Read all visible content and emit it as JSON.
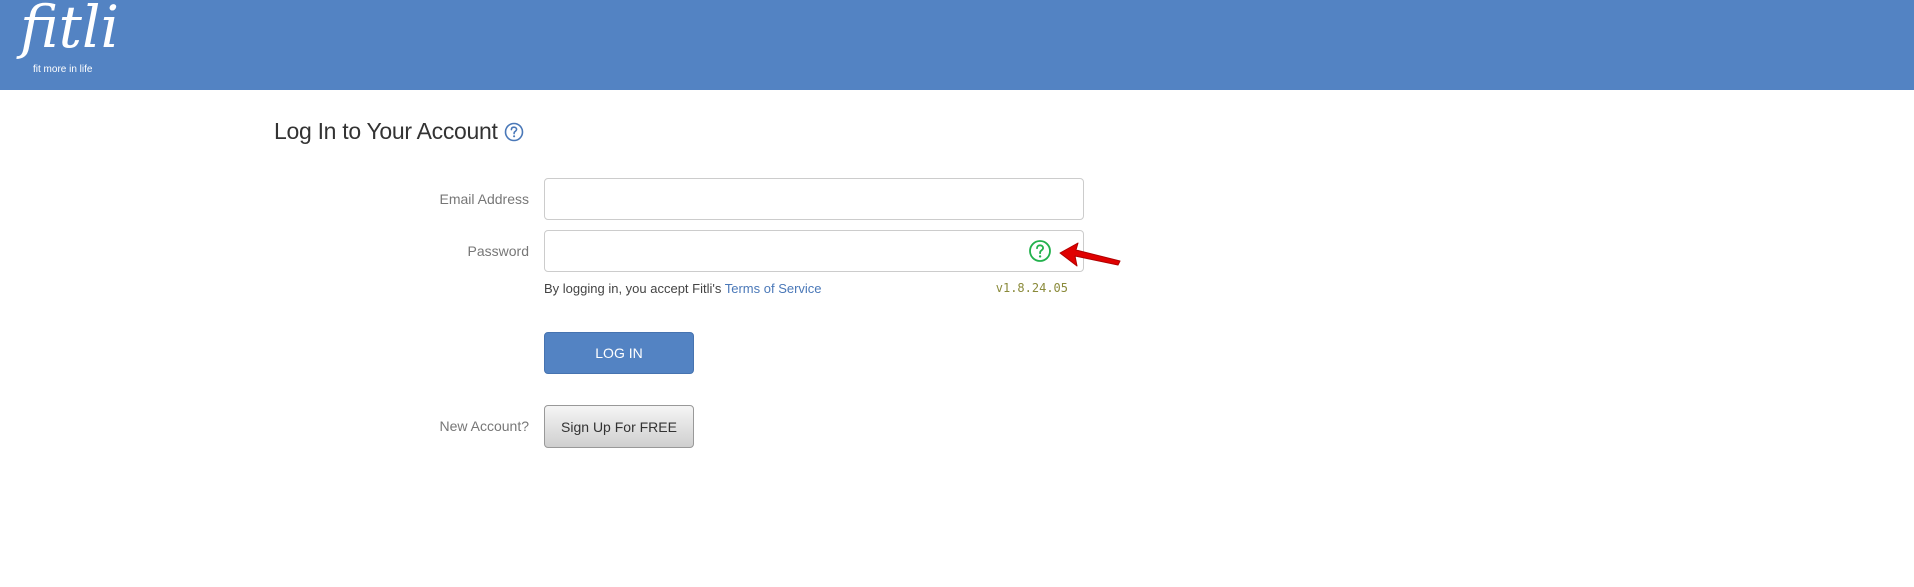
{
  "header": {
    "logo_text": "fitli",
    "logo_tagline": "fit more in life",
    "bg_color": "#5383c3"
  },
  "login": {
    "title": "Log In to Your Account",
    "title_help_icon": "question-circle-icon",
    "email_label": "Email Address",
    "email_value": "",
    "password_label": "Password",
    "password_value": "",
    "password_help_icon": "question-circle-icon",
    "terms_prefix": "By logging in, you accept Fitli's ",
    "terms_link": "Terms of Service",
    "version": "v1.8.24.05",
    "login_button": "LOG IN",
    "new_account_label": "New Account?",
    "signup_button": "Sign Up For FREE"
  },
  "colors": {
    "accent": "#5383c3",
    "link": "#4a78b8",
    "help_icon_title": "#4a78b8",
    "help_icon_password": "#22b14c",
    "annotation_arrow": "#e00000"
  }
}
